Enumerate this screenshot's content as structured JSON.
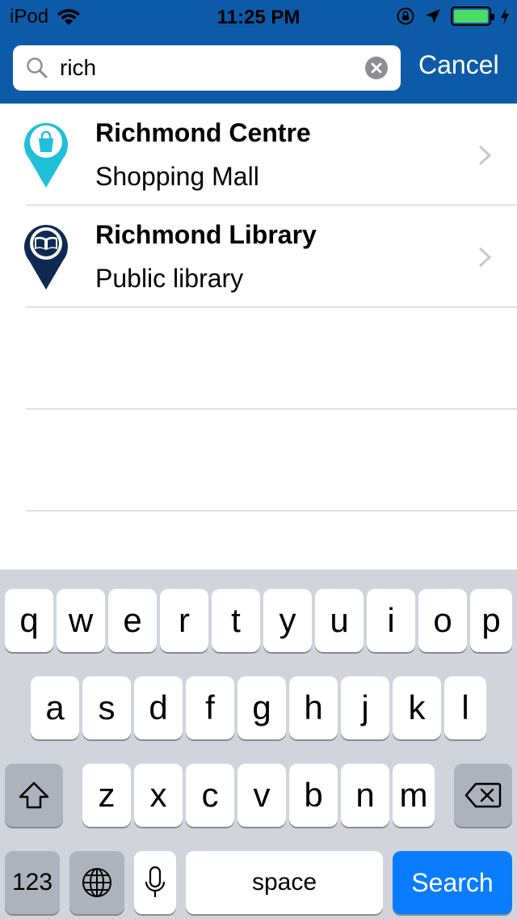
{
  "status_bar": {
    "carrier": "iPod",
    "time": "11:25 PM",
    "battery_color": "#4cd964"
  },
  "search": {
    "value": "rich",
    "placeholder": "",
    "cancel_label": "Cancel",
    "accent_color": "#0d5ba8"
  },
  "results": [
    {
      "title": "Richmond Centre",
      "subtitle": "Shopping Mall",
      "icon": "shopping-bag-pin-icon",
      "pin_color": "#1fc0d8"
    },
    {
      "title": "Richmond Library",
      "subtitle": "Public library",
      "icon": "book-pin-icon",
      "pin_color": "#0f2a52"
    }
  ],
  "keyboard": {
    "row1": [
      "q",
      "w",
      "e",
      "r",
      "t",
      "y",
      "u",
      "i",
      "o",
      "p"
    ],
    "row2": [
      "a",
      "s",
      "d",
      "f",
      "g",
      "h",
      "j",
      "k",
      "l"
    ],
    "row3": [
      "z",
      "x",
      "c",
      "v",
      "b",
      "n",
      "m"
    ],
    "numbers_label": "123",
    "space_label": "space",
    "search_label": "Search",
    "search_color": "#0a7cfe"
  }
}
